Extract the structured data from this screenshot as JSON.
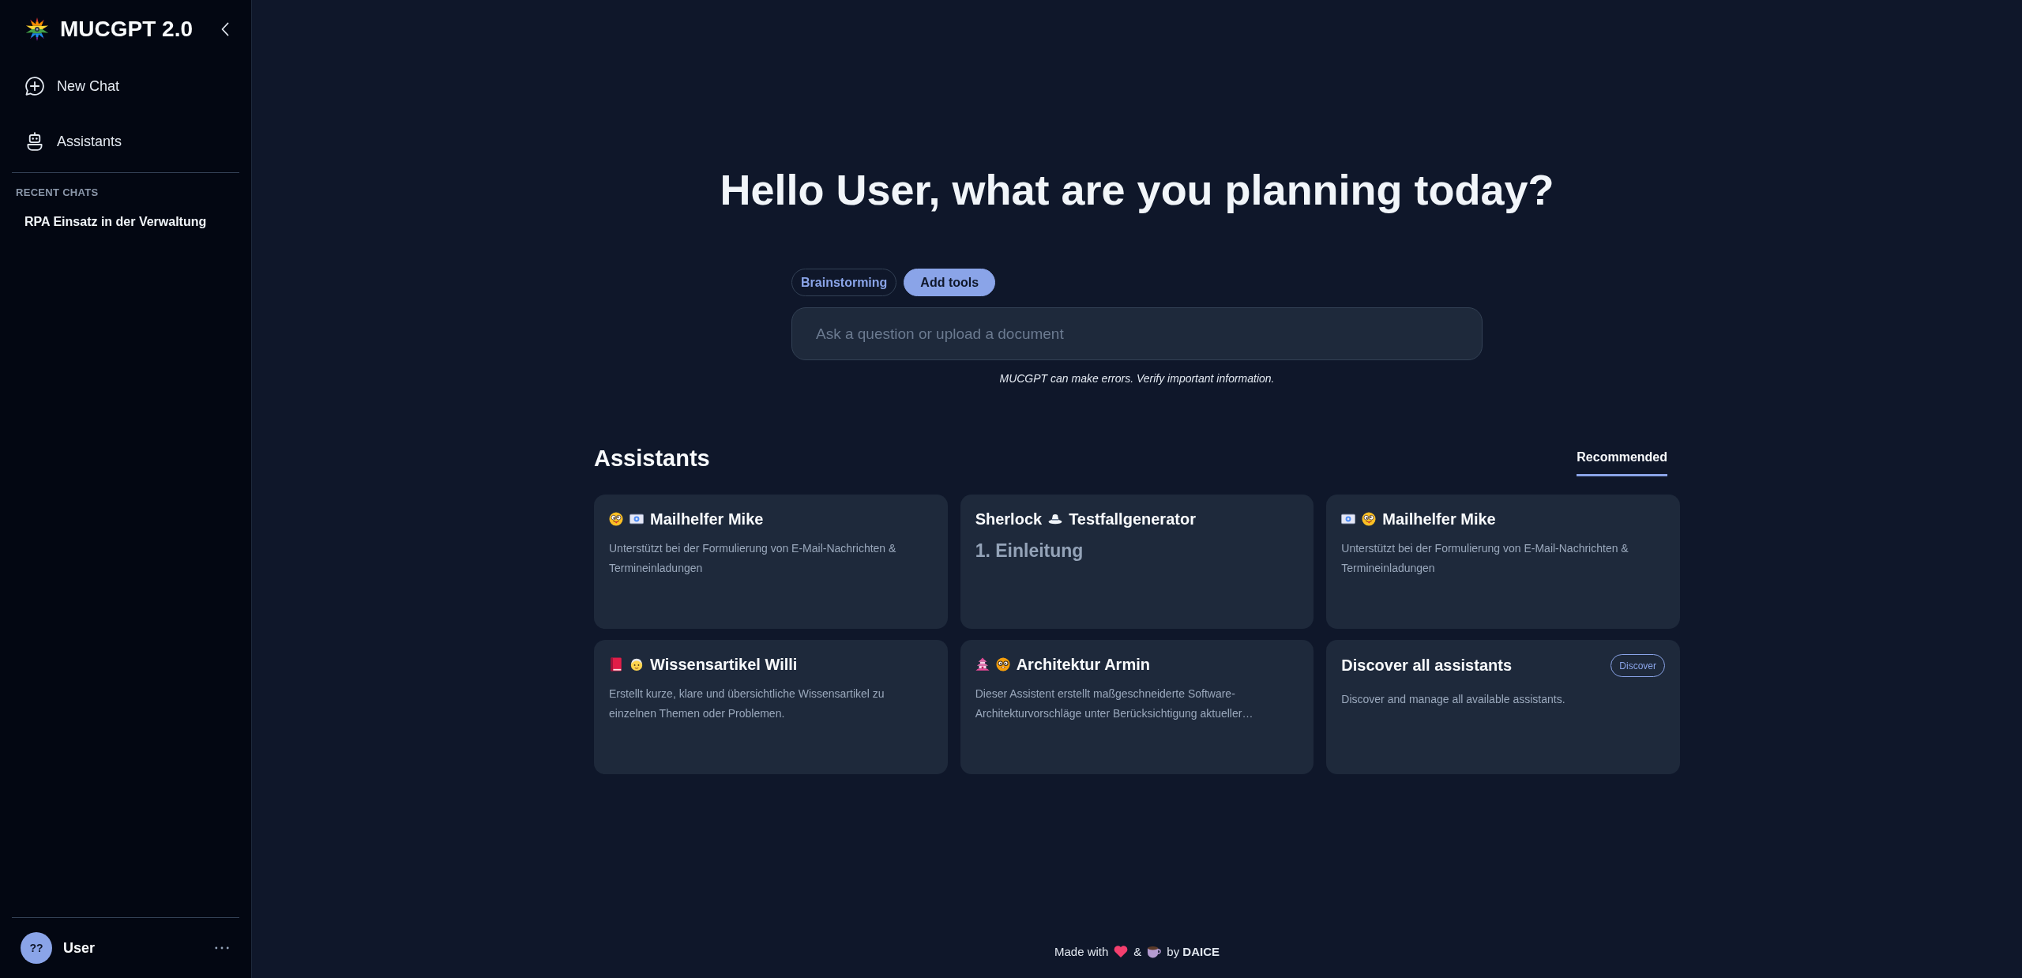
{
  "sidebar": {
    "brand": "MUCGPT 2.0",
    "nav": [
      {
        "label": "New Chat"
      },
      {
        "label": "Assistants"
      }
    ],
    "recent_heading": "RECENT CHATS",
    "recent_chats": [
      {
        "title": "RPA Einsatz in der Verwaltung"
      }
    ],
    "user": {
      "initials": "??",
      "name": "User"
    }
  },
  "main": {
    "greeting": "Hello User, what are you planning today?",
    "tool_chips": [
      {
        "label": "Brainstorming"
      }
    ],
    "add_tools_button": "Add tools",
    "input": {
      "placeholder": "Ask a question or upload a document"
    },
    "disclaimer": "MUCGPT can make errors. Verify important information."
  },
  "assistants": {
    "heading": "Assistants",
    "tabs": [
      {
        "label": "Recommended",
        "selected": true
      }
    ],
    "cards": [
      {
        "kind": "plain",
        "title": [
          "Mailhelfer Mike"
        ],
        "description": "Unterstützt bei der Formulierung von E-Mail-Nachrichten & Termineinladungen"
      },
      {
        "kind": "heading",
        "title": [
          "Sherlock",
          "Testfallgenerator"
        ],
        "description": "1. Einleitung"
      },
      {
        "kind": "plain",
        "title": [
          "Mailhelfer Mike"
        ],
        "description": "Unterstützt bei der Formulierung von E-Mail-Nachrichten & Termineinladungen"
      },
      {
        "kind": "plain",
        "title": [
          "Wissensartikel Willi"
        ],
        "description": "Erstellt kurze, klare und übersichtliche Wissensartikel zu einzelnen Themen oder Problemen."
      },
      {
        "kind": "plain",
        "title": [
          "Architektur Armin"
        ],
        "description": "Dieser Assistent erstellt maßgeschneiderte Software-Architekturvorschläge unter Berücksichtigung aktueller…"
      },
      {
        "kind": "discover",
        "title": [
          "Discover all assistants"
        ],
        "description": "Discover and manage all available assistants.",
        "button": "Discover"
      }
    ]
  },
  "footer": {
    "made_with": "Made with",
    "and": "&",
    "by": "by **DAICE**"
  }
}
